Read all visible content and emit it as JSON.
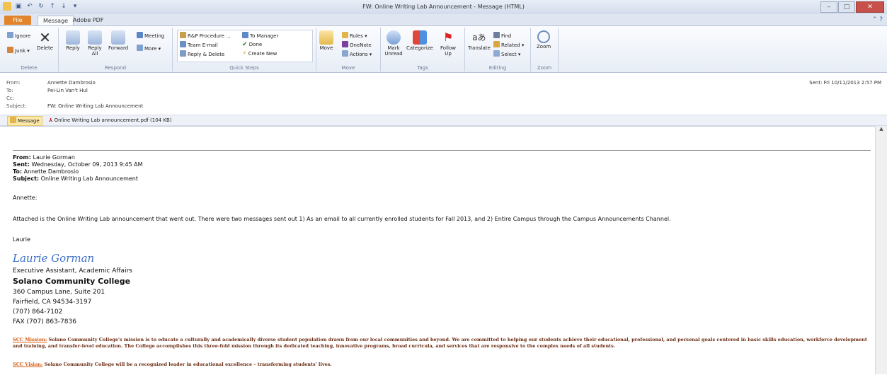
{
  "window": {
    "title": "FW: Online Writing Lab Announcement - Message (HTML)"
  },
  "tabs": {
    "file": "File",
    "message": "Message",
    "adobe": "Adobe PDF"
  },
  "ribbon": {
    "delete": {
      "ignore": "Ignore",
      "junk": "Junk",
      "delete": "Delete",
      "group": "Delete"
    },
    "respond": {
      "reply": "Reply",
      "reply_all": "Reply All",
      "forward": "Forward",
      "meeting": "Meeting",
      "more": "More",
      "group": "Respond"
    },
    "quicksteps": {
      "rp": "R&P Procedure ...",
      "team": "Team E-mail",
      "reply_delete": "Reply & Delete",
      "manager": "To Manager",
      "done": "Done",
      "create": "Create New",
      "group": "Quick Steps"
    },
    "move": {
      "move": "Move",
      "rules": "Rules",
      "onenote": "OneNote",
      "actions": "Actions",
      "group": "Move"
    },
    "tags": {
      "mark": "Mark Unread",
      "categorize": "Categorize",
      "follow": "Follow Up",
      "group": "Tags"
    },
    "editing": {
      "translate": "Translate",
      "find": "Find",
      "related": "Related",
      "select": "Select",
      "group": "Editing"
    },
    "zoom": {
      "zoom": "Zoom",
      "group": "Zoom"
    }
  },
  "header": {
    "from_label": "From:",
    "from": "Annette Dambrosio",
    "to_label": "To:",
    "to": "Pei-Lin Van't Hul",
    "cc_label": "Cc:",
    "cc": "",
    "subject_label": "Subject:",
    "subject": "FW: Online Writing Lab Announcement",
    "sent": "Sent:  Fri 10/11/2013 2:57 PM"
  },
  "attachments": {
    "message": "Message",
    "pdf": "Online Writing Lab announcement.pdf (104 KB)"
  },
  "email": {
    "from_label": "From:",
    "from": "Laurie Gorman",
    "sent_label": "Sent:",
    "sent": "Wednesday, October 09, 2013 9:45 AM",
    "to_label": "To:",
    "to": "Annette Dambrosio",
    "subject_label": "Subject:",
    "subject": "Online Writing Lab Announcement",
    "greeting": "Annette:",
    "body": "Attached is the Online Writing Lab announcement that went out.  There were two messages sent out 1) As an email to all currently enrolled students for Fall 2013, and 2)  Entire Campus through the Campus Announcements Channel.",
    "closing": "Laurie",
    "signature": "Laurie Gorman",
    "sig_title": "Executive Assistant, Academic Affairs",
    "college": "Solano Community College",
    "address1": "360 Campus Lane, Suite 201",
    "address2": "Fairfield, CA 94534-3197",
    "phone": "(707) 864-7102",
    "fax": "FAX (707) 863-7836",
    "mission_label": "SCC Mission:",
    "mission": "Solano Community College's mission is to educate a culturally and academically diverse student population drawn from our local communities and beyond.  We are committed to helping our students achieve their educational, professional, and personal goals centered in basic skills education, workforce development and training, and transfer-level education. The College accomplishes this three-fold mission through its dedicated teaching, innovative programs, broad curricula, and services that are responsive to the complex needs of all students.",
    "vision_label": "SCC Vision:",
    "vision": "Solano Community College will be a recognized leader in educational excellence – transforming students' lives."
  }
}
